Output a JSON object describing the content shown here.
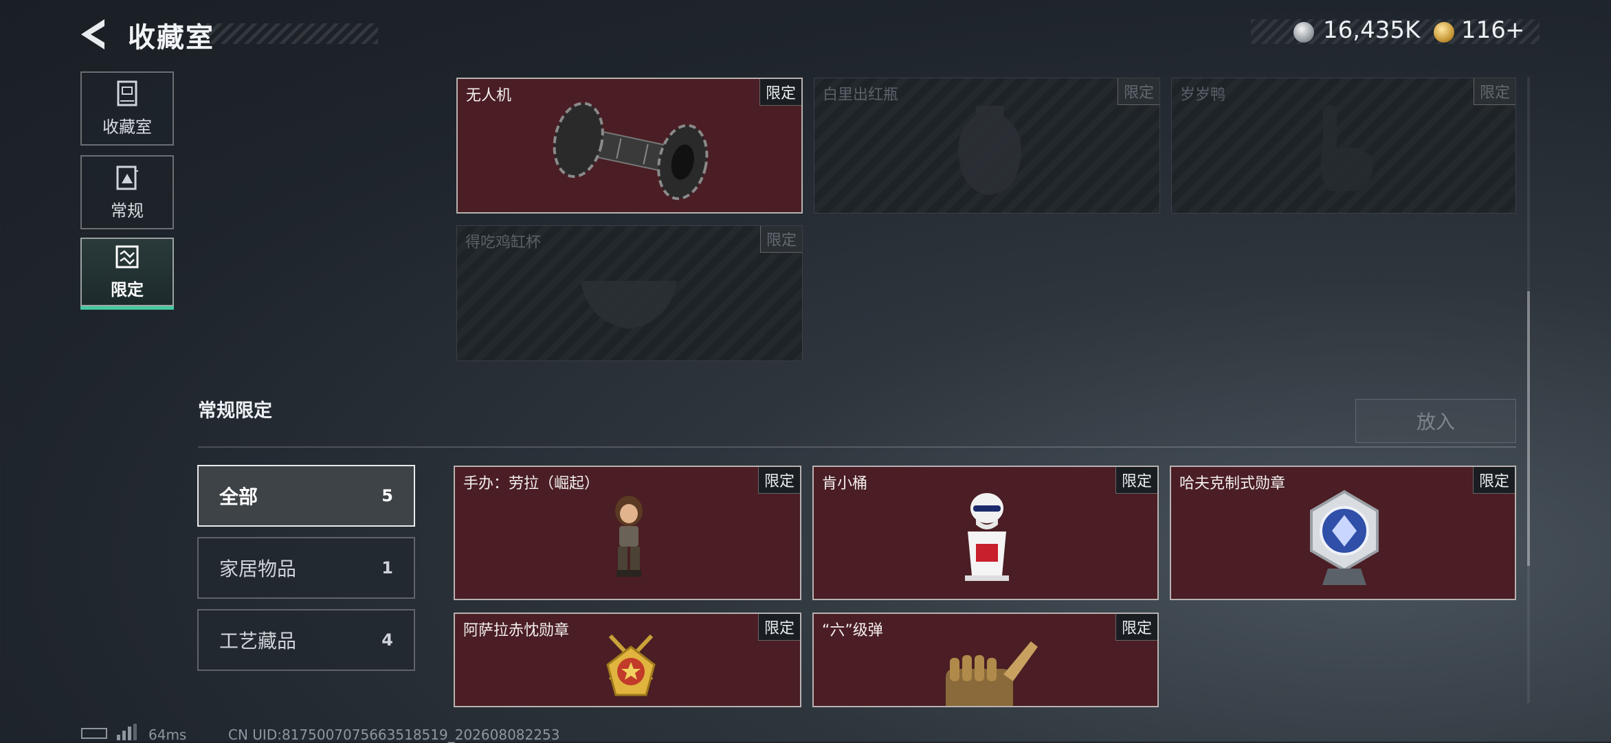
{
  "header": {
    "title": "收藏室",
    "silver_amount": "16,435K",
    "gold_amount": "116",
    "gold_plus": "+"
  },
  "nav": [
    {
      "label": "收藏室",
      "icon": "collection-room-icon"
    },
    {
      "label": "常规",
      "icon": "regular-icon"
    },
    {
      "label": "限定",
      "icon": "limited-icon",
      "active": true
    }
  ],
  "top_cards": [
    {
      "name": "无人机",
      "badge": "限定",
      "owned": true,
      "icon": "drone-icon"
    },
    {
      "name": "白里出红瓶",
      "badge": "限定",
      "owned": false,
      "icon": "vase-icon"
    },
    {
      "name": "岁岁鸭",
      "badge": "限定",
      "owned": false,
      "icon": "duck-icon"
    },
    {
      "name": "得吃鸡缸杯",
      "badge": "限定",
      "owned": false,
      "icon": "cup-icon"
    }
  ],
  "section": {
    "title": "常规限定",
    "put_button": "放入"
  },
  "filters": [
    {
      "label": "全部",
      "count": "5",
      "active": true
    },
    {
      "label": "家居物品",
      "count": "1"
    },
    {
      "label": "工艺藏品",
      "count": "4"
    }
  ],
  "bottom_cards": [
    {
      "name": "手办：劳拉（崛起）",
      "badge": "限定",
      "icon": "lara-figure-icon"
    },
    {
      "name": "肯小桶",
      "badge": "限定",
      "icon": "kfc-bucket-figure-icon"
    },
    {
      "name": "哈夫克制式勋章",
      "badge": "限定",
      "icon": "haavk-medal-icon"
    },
    {
      "name": "阿萨拉赤忱勋章",
      "badge": "限定",
      "icon": "asara-medal-icon"
    },
    {
      "name": "“六”级弹",
      "badge": "限定",
      "icon": "six-bullet-hand-icon"
    }
  ],
  "footer": {
    "ping": "64ms",
    "uid": "CN UID:8175007075663518519_202608082253"
  },
  "colors": {
    "owned_card": "#4a1e24",
    "active_accent": "#46c9a0"
  }
}
